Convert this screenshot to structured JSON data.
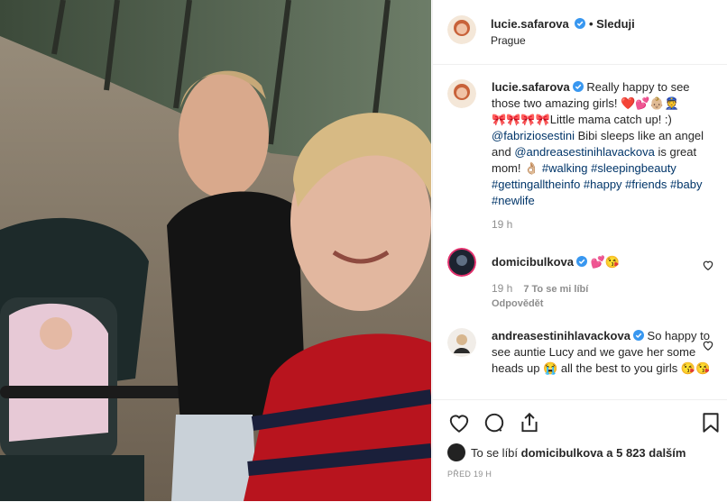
{
  "post": {
    "author": "lucie.safarova",
    "follow_label": "• Sleduji",
    "location": "Prague"
  },
  "caption": {
    "author": "lucie.safarova",
    "line1": "Really happy to see those two amazing girls! ❤️💕👶🏼👮",
    "line2": "🎀🎀🎀🎀Little mama catch up! :)",
    "mention1": "@fabriziosestini",
    "text2": " Bibi sleeps like an angel and ",
    "mention2": "@andreasestinihlavackova",
    "text3": " is great mom! 👌🏼 ",
    "tags": "#walking #sleepingbeauty #gettingalltheinfo #happy #friends #baby #newlife",
    "time": "19 h"
  },
  "comments": [
    {
      "author": "domicibulkova",
      "text": "💕😘",
      "time": "19 h",
      "likes": "7 To se mi líbí",
      "reply": "Odpovědět"
    },
    {
      "author": "andreasestinihlavackova",
      "text": "So happy to see auntie Lucy and we gave her some heads up 😭 all the best to you girls 😘😘"
    }
  ],
  "likes": {
    "prefix": "To se líbí ",
    "user": "domicibulkova",
    "suffix": " a 5 823 dalším"
  },
  "date": "PŘED 19 H",
  "colors": {
    "link": "#003569",
    "verified": "#3897f0",
    "muted": "#8e8e8e"
  }
}
